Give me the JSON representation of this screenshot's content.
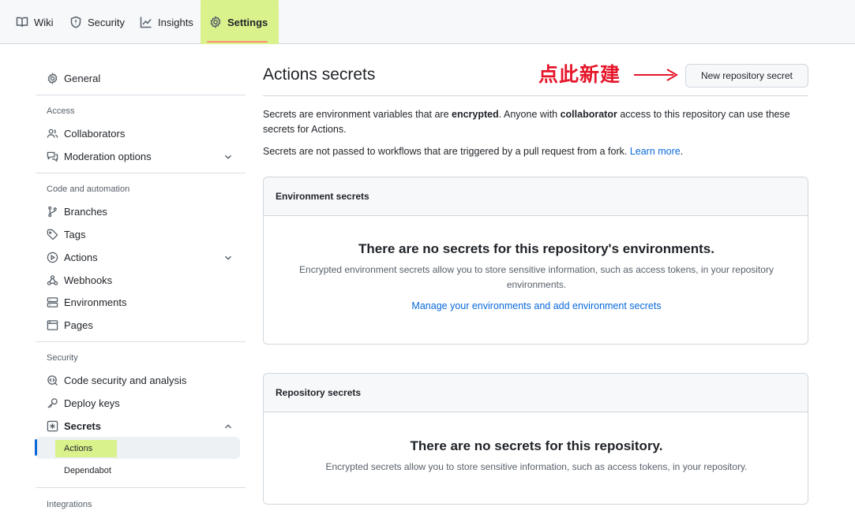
{
  "tabs": [
    {
      "label": "Wiki",
      "icon": "book-icon"
    },
    {
      "label": "Security",
      "icon": "shield-icon"
    },
    {
      "label": "Insights",
      "icon": "graph-icon"
    },
    {
      "label": "Settings",
      "icon": "gear-icon",
      "active": true
    }
  ],
  "sidebar": {
    "general": "General",
    "access_heading": "Access",
    "collaborators": "Collaborators",
    "moderation": "Moderation options",
    "code_heading": "Code and automation",
    "branches": "Branches",
    "tags": "Tags",
    "actions": "Actions",
    "webhooks": "Webhooks",
    "environments": "Environments",
    "pages": "Pages",
    "security_heading": "Security",
    "code_security": "Code security and analysis",
    "deploy_keys": "Deploy keys",
    "secrets": "Secrets",
    "secrets_actions": "Actions",
    "secrets_dependabot": "Dependabot",
    "integrations_heading": "Integrations"
  },
  "main": {
    "title": "Actions secrets",
    "annotation": "点此新建",
    "new_button": "New repository secret",
    "intro_1": "Secrets are environment variables that are ",
    "intro_encrypted": "encrypted",
    "intro_2": ". Anyone with ",
    "intro_collaborator": "collaborator",
    "intro_3": " access to this repository can use these secrets for Actions.",
    "fork_note": "Secrets are not passed to workflows that are triggered by a pull request from a fork. ",
    "learn_more": "Learn more",
    "period": ".",
    "env_box": {
      "header": "Environment secrets",
      "title": "There are no secrets for this repository's environments.",
      "desc": "Encrypted environment secrets allow you to store sensitive information, such as access tokens, in your repository environments.",
      "link": "Manage your environments and add environment secrets"
    },
    "repo_box": {
      "header": "Repository secrets",
      "title": "There are no secrets for this repository.",
      "desc": "Encrypted secrets allow you to store sensitive information, such as access tokens, in your repository."
    }
  },
  "colors": {
    "highlight": "#d9f28c",
    "link": "#0969da",
    "annotation": "#e5162a",
    "active_underline": "#fd8c73"
  }
}
